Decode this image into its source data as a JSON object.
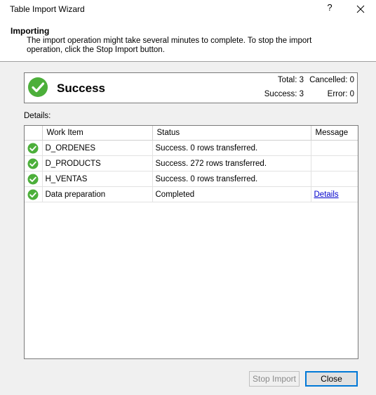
{
  "window": {
    "title": "Table Import Wizard",
    "help_glyph": "?"
  },
  "header": {
    "title": "Importing",
    "description": "The import operation might take several minutes to complete. To stop the import operation, click the Stop Import button."
  },
  "status": {
    "text": "Success",
    "total_label": "Total: 3",
    "cancelled_label": "Cancelled: 0",
    "success_label": "Success: 3",
    "error_label": "Error: 0",
    "icon": "success-check-icon",
    "icon_color": "#4caf3a"
  },
  "details": {
    "label": "Details:",
    "columns": [
      "Work Item",
      "Status",
      "Message"
    ],
    "rows": [
      {
        "work_item": "D_ORDENES",
        "status": "Success. 0 rows transferred.",
        "message": ""
      },
      {
        "work_item": "D_PRODUCTS",
        "status": "Success. 272 rows transferred.",
        "message": ""
      },
      {
        "work_item": "H_VENTAS",
        "status": "Success. 0 rows transferred.",
        "message": ""
      },
      {
        "work_item": "Data preparation",
        "status": "Completed",
        "message": "Details"
      }
    ]
  },
  "buttons": {
    "stop_import": "Stop Import",
    "close": "Close"
  },
  "colors": {
    "accent": "#0078d7",
    "link": "#0000cc",
    "success": "#4caf3a"
  }
}
